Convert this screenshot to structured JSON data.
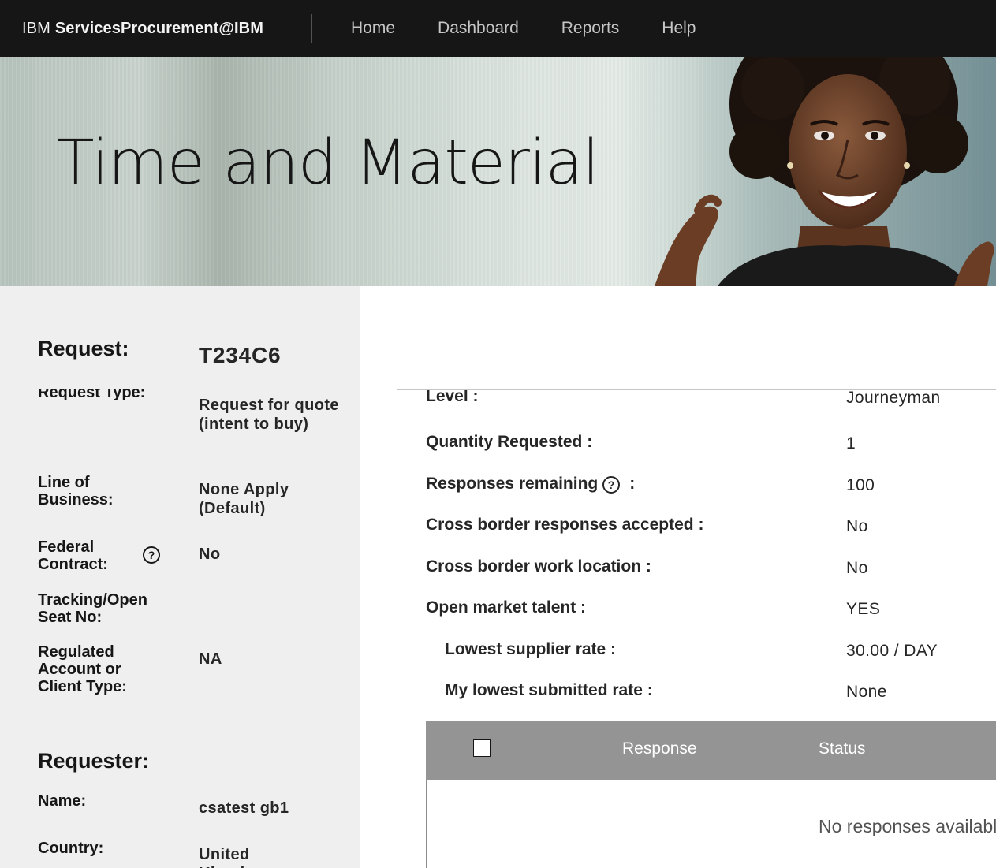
{
  "topnav": {
    "brand_prefix": "IBM",
    "brand_name": "ServicesProcurement@IBM",
    "links": [
      "Home",
      "Dashboard",
      "Reports",
      "Help"
    ]
  },
  "hero": {
    "title": "Time and Material"
  },
  "request": {
    "heading": "Request:",
    "id": "T234C6",
    "fields": [
      {
        "label": "Request Type:",
        "value": "Request for quote (intent to buy)"
      },
      {
        "label": "Line of Business:",
        "value": "None Apply (Default)"
      },
      {
        "label": "Federal Contract:",
        "value": "No"
      },
      {
        "label": "Tracking/Open Seat No:",
        "value": ""
      },
      {
        "label": "Regulated Account or Client Type:",
        "value": "NA"
      }
    ]
  },
  "requester": {
    "heading": "Requester:",
    "fields": [
      {
        "label": "Name:",
        "value": "csatest gb1"
      },
      {
        "label": "Country:",
        "value": "United Kingdom"
      }
    ]
  },
  "details": {
    "rows": [
      {
        "label": "Level :",
        "value": "Journeyman"
      },
      {
        "label": "Quantity Requested :",
        "value": "1"
      },
      {
        "label": "Responses remaining",
        "suffix": ":",
        "value": "100"
      },
      {
        "label": "Cross border responses accepted :",
        "value": "No"
      },
      {
        "label": "Cross border work location :",
        "value": "No"
      },
      {
        "label": "Open market talent :",
        "value": "YES"
      },
      {
        "label": "Lowest supplier rate :",
        "value": "30.00 / DAY"
      },
      {
        "label": "My lowest submitted rate :",
        "value": "None"
      }
    ]
  },
  "responses_table": {
    "columns": [
      "Response",
      "Status"
    ],
    "empty_message": "No responses available"
  },
  "colors": {
    "nav_bg": "#161616",
    "panel_bg": "#efefef",
    "table_header": "#949494"
  }
}
